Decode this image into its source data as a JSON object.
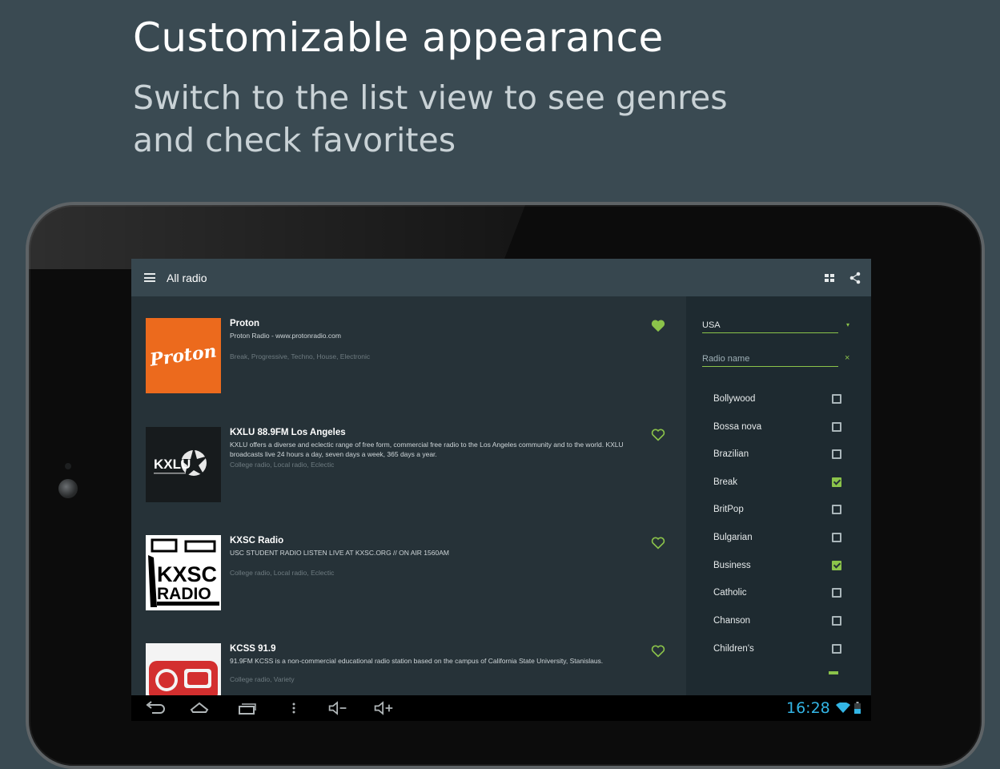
{
  "promo": {
    "headline": "Customizable appearance",
    "subline": "Switch to the list view to see genres and check favorites"
  },
  "appbar": {
    "title": "All radio",
    "menu_icon": "menu-icon",
    "actions": [
      "grid-view-icon",
      "share-icon"
    ]
  },
  "stations": [
    {
      "name": "Proton",
      "logo_text": "Proton",
      "description": "Proton Radio - www.protonradio.com",
      "genres": "Break, Progressive, Techno, House, Electronic",
      "favorite": true
    },
    {
      "name": "KXLU 88.9FM Los Angeles",
      "logo_text": "KXLU",
      "description": "KXLU offers a diverse and eclectic range of free form, commercial free radio to the Los Angeles community and to the world. KXLU broadcasts live 24 hours a day, seven days a week, 365 days a year.",
      "genres": "College radio, Local radio, Eclectic",
      "favorite": false
    },
    {
      "name": "KXSC Radio",
      "logo_text": "KXSC RADIO",
      "description": "USC STUDENT RADIO LISTEN LIVE AT KXSC.ORG // ON AIR 1560AM",
      "genres": "College radio, Local radio, Eclectic",
      "favorite": false
    },
    {
      "name": "KCSS 91.9",
      "logo_text": "",
      "description": "91.9FM KCSS is a non-commercial educational radio station based on the campus of California State University, Stanislaus.",
      "genres": "College radio, Variety",
      "favorite": false
    }
  ],
  "filters": {
    "country": "USA",
    "search_placeholder": "Radio name",
    "clear_icon": "×",
    "dropdown_icon": "▾",
    "genres": [
      {
        "label": "Bollywood",
        "checked": false
      },
      {
        "label": "Bossa nova",
        "checked": false
      },
      {
        "label": "Brazilian",
        "checked": false
      },
      {
        "label": "Break",
        "checked": true
      },
      {
        "label": "BritPop",
        "checked": false
      },
      {
        "label": "Bulgarian",
        "checked": false
      },
      {
        "label": "Business",
        "checked": true
      },
      {
        "label": "Catholic",
        "checked": false
      },
      {
        "label": "Chanson",
        "checked": false
      },
      {
        "label": "Children's",
        "checked": false
      }
    ]
  },
  "system_bar": {
    "time": "16:28",
    "buttons": [
      "back-icon",
      "home-icon",
      "recents-icon",
      "overflow-menu-icon",
      "volume-down-icon",
      "volume-up-icon"
    ],
    "status_icons": [
      "wifi-icon",
      "battery-icon"
    ]
  },
  "colors": {
    "accent": "#8bc34a",
    "background": "#3a4a52",
    "appbar": "#37474f",
    "list_bg": "#263238",
    "clock": "#33b5e5"
  }
}
